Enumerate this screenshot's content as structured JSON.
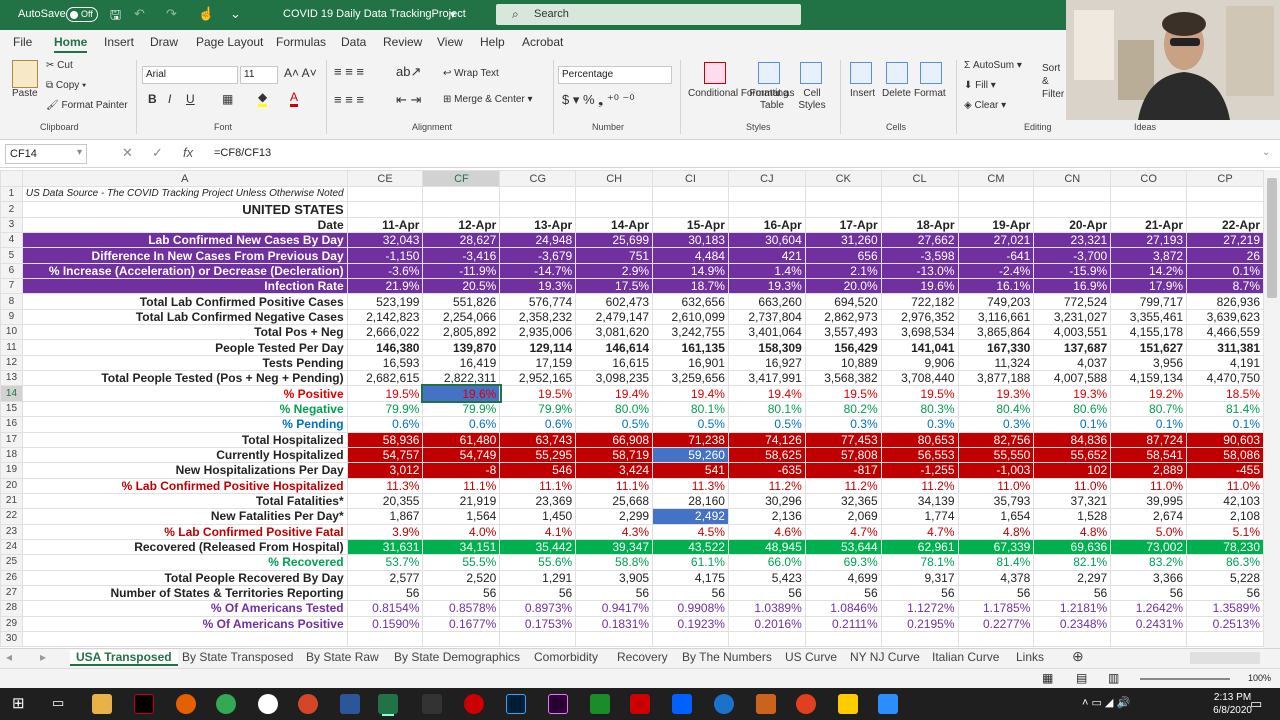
{
  "title_bar": {
    "autosave_label": "AutoSave",
    "autosave_state": "Off",
    "file_name": "COVID 19 Daily Data TrackingProject",
    "search_placeholder": "Search"
  },
  "menu": [
    "File",
    "Home",
    "Insert",
    "Draw",
    "Page Layout",
    "Formulas",
    "Data",
    "Review",
    "View",
    "Help",
    "Acrobat"
  ],
  "ribbon": {
    "paste": "Paste",
    "cut": "Cut",
    "copy": "Copy",
    "format_painter": "Format Painter",
    "clipboard": "Clipboard",
    "font_name": "Arial",
    "font_size": "11",
    "font": "Font",
    "wrap_text": "Wrap Text",
    "merge_center": "Merge & Center",
    "alignment": "Alignment",
    "number_format": "Percentage",
    "number": "Number",
    "conditional_formatting": "Conditional Formatting",
    "format_as_table": "Format as Table",
    "cell_styles": "Cell Styles",
    "styles": "Styles",
    "insert": "Insert",
    "delete": "Delete",
    "format": "Format",
    "cells": "Cells",
    "autosum": "AutoSum",
    "fill": "Fill",
    "clear": "Clear",
    "sort_filter": "Sort & Filter",
    "editing": "Editing",
    "ideas": "Ideas"
  },
  "formula_bar": {
    "name_box": "CF14",
    "formula": "=CF8/CF13",
    "fx": "fx"
  },
  "columns": [
    "A",
    "CE",
    "CF",
    "CG",
    "CH",
    "CI",
    "CJ",
    "CK",
    "CL",
    "CM",
    "CN",
    "CO",
    "CP"
  ],
  "rows": [
    {
      "n": "1",
      "cls": "",
      "label": "US Data Source - The COVID Tracking Project Unless Otherwise Noted",
      "vals": [
        "",
        "",
        "",
        "",
        "",
        "",
        "",
        "",
        "",
        "",
        "",
        ""
      ]
    },
    {
      "n": "2",
      "cls": "",
      "label": "UNITED STATES",
      "vals": [
        "",
        "",
        "",
        "",
        "",
        "",
        "",
        "",
        "",
        "",
        "",
        ""
      ]
    },
    {
      "n": "3",
      "cls": "",
      "label": "Date",
      "vals": [
        "11-Apr",
        "12-Apr",
        "13-Apr",
        "14-Apr",
        "15-Apr",
        "16-Apr",
        "17-Apr",
        "18-Apr",
        "19-Apr",
        "20-Apr",
        "21-Apr",
        "22-Apr"
      ]
    },
    {
      "n": "4",
      "cls": "purple",
      "label": "Lab Confirmed New Cases By Day",
      "vals": [
        "32,043",
        "28,627",
        "24,948",
        "25,699",
        "30,183",
        "30,604",
        "31,260",
        "27,662",
        "27,021",
        "23,321",
        "27,193",
        "27,219"
      ]
    },
    {
      "n": "5",
      "cls": "purple",
      "label": "Difference In New Cases From Previous Day",
      "vals": [
        "-1,150",
        "-3,416",
        "-3,679",
        "751",
        "4,484",
        "421",
        "656",
        "-3,598",
        "-641",
        "-3,700",
        "3,872",
        "26"
      ]
    },
    {
      "n": "6",
      "cls": "purple",
      "label": "% Increase (Acceleration) or Decrease (Decleration)",
      "vals": [
        "-3.6%",
        "-11.9%",
        "-14.7%",
        "2.9%",
        "14.9%",
        "1.4%",
        "2.1%",
        "-13.0%",
        "-2.4%",
        "-15.9%",
        "14.2%",
        "0.1%"
      ]
    },
    {
      "n": "7",
      "cls": "purple",
      "label": "Infection Rate",
      "vals": [
        "21.9%",
        "20.5%",
        "19.3%",
        "17.5%",
        "18.7%",
        "19.3%",
        "20.0%",
        "19.6%",
        "16.1%",
        "16.9%",
        "17.9%",
        "8.7%"
      ]
    },
    {
      "n": "8",
      "cls": "",
      "label": "Total Lab Confirmed Positive Cases",
      "vals": [
        "523,199",
        "551,826",
        "576,774",
        "602,473",
        "632,656",
        "663,260",
        "694,520",
        "722,182",
        "749,203",
        "772,524",
        "799,717",
        "826,936"
      ]
    },
    {
      "n": "9",
      "cls": "",
      "label": "Total Lab Confirmed Negative Cases",
      "vals": [
        "2,142,823",
        "2,254,066",
        "2,358,232",
        "2,479,147",
        "2,610,099",
        "2,737,804",
        "2,862,973",
        "2,976,352",
        "3,116,661",
        "3,231,027",
        "3,355,461",
        "3,639,623"
      ]
    },
    {
      "n": "10",
      "cls": "",
      "label": "Total Pos + Neg",
      "vals": [
        "2,666,022",
        "2,805,892",
        "2,935,006",
        "3,081,620",
        "3,242,755",
        "3,401,064",
        "3,557,493",
        "3,698,534",
        "3,865,864",
        "4,003,551",
        "4,155,178",
        "4,466,559"
      ]
    },
    {
      "n": "11",
      "cls": "",
      "label": "People Tested Per Day",
      "vals": [
        "146,380",
        "139,870",
        "129,114",
        "146,614",
        "161,135",
        "158,309",
        "156,429",
        "141,041",
        "167,330",
        "137,687",
        "151,627",
        "311,381"
      ]
    },
    {
      "n": "12",
      "cls": "",
      "label": "Tests Pending",
      "vals": [
        "16,593",
        "16,419",
        "17,159",
        "16,615",
        "16,901",
        "16,927",
        "10,889",
        "9,906",
        "11,324",
        "4,037",
        "3,956",
        "4,191"
      ]
    },
    {
      "n": "13",
      "cls": "",
      "label": "Total People Tested (Pos + Neg + Pending)",
      "vals": [
        "2,682,615",
        "2,822,311",
        "2,952,165",
        "3,098,235",
        "3,259,656",
        "3,417,991",
        "3,568,382",
        "3,708,440",
        "3,877,188",
        "4,007,588",
        "4,159,134",
        "4,470,750"
      ]
    },
    {
      "n": "14",
      "cls": "cpos",
      "label": "% Positive",
      "vals": [
        "19.5%",
        "19.6%",
        "19.5%",
        "19.4%",
        "19.4%",
        "19.4%",
        "19.5%",
        "19.5%",
        "19.3%",
        "19.3%",
        "19.2%",
        "18.5%"
      ]
    },
    {
      "n": "15",
      "cls": "cneg",
      "label": "% Negative",
      "vals": [
        "79.9%",
        "79.9%",
        "79.9%",
        "80.0%",
        "80.1%",
        "80.1%",
        "80.2%",
        "80.3%",
        "80.4%",
        "80.6%",
        "80.7%",
        "81.4%"
      ]
    },
    {
      "n": "16",
      "cls": "cpen",
      "label": "% Pending",
      "vals": [
        "0.6%",
        "0.6%",
        "0.6%",
        "0.5%",
        "0.5%",
        "0.5%",
        "0.3%",
        "0.3%",
        "0.3%",
        "0.1%",
        "0.1%",
        "0.1%"
      ]
    },
    {
      "n": "17",
      "cls": "red",
      "label": "Total Hospitalized",
      "vals": [
        "58,936",
        "61,480",
        "63,743",
        "66,908",
        "71,238",
        "74,126",
        "77,453",
        "80,653",
        "82,756",
        "84,836",
        "87,724",
        "90,603"
      ]
    },
    {
      "n": "18",
      "cls": "red",
      "label": "Currently Hospitalized",
      "vals": [
        "54,757",
        "54,749",
        "55,295",
        "58,719",
        "59,260",
        "58,625",
        "57,808",
        "56,553",
        "55,550",
        "55,652",
        "58,541",
        "58,086"
      ]
    },
    {
      "n": "19",
      "cls": "red",
      "label": "New Hospitalizations Per Day",
      "vals": [
        "3,012",
        "-8",
        "546",
        "3,424",
        "541",
        "-635",
        "-817",
        "-1,255",
        "-1,003",
        "102",
        "2,889",
        "-455"
      ]
    },
    {
      "n": "20",
      "cls": "cdred",
      "label": "% Lab Confirmed Positive Hospitalized",
      "vals": [
        "11.3%",
        "11.1%",
        "11.1%",
        "11.1%",
        "11.3%",
        "11.2%",
        "11.2%",
        "11.2%",
        "11.0%",
        "11.0%",
        "11.0%",
        "11.0%"
      ]
    },
    {
      "n": "21",
      "cls": "",
      "label": "Total Fatalities*",
      "vals": [
        "20,355",
        "21,919",
        "23,369",
        "25,668",
        "28,160",
        "30,296",
        "32,365",
        "34,139",
        "35,793",
        "37,321",
        "39,995",
        "42,103"
      ]
    },
    {
      "n": "22",
      "cls": "",
      "label": "New Fatalities Per Day*",
      "vals": [
        "1,867",
        "1,564",
        "1,450",
        "2,299",
        "2,492",
        "2,136",
        "2,069",
        "1,774",
        "1,654",
        "1,528",
        "2,674",
        "2,108"
      ]
    },
    {
      "n": "23",
      "cls": "cdred",
      "label": "% Lab Confirmed Positive Fatal",
      "vals": [
        "3.9%",
        "4.0%",
        "4.1%",
        "4.3%",
        "4.5%",
        "4.6%",
        "4.7%",
        "4.7%",
        "4.8%",
        "4.8%",
        "5.0%",
        "5.1%"
      ]
    },
    {
      "n": "24",
      "cls": "green",
      "label": "Recovered (Released From Hospital)",
      "vals": [
        "31,631",
        "34,151",
        "35,442",
        "39,347",
        "43,522",
        "48,945",
        "53,644",
        "62,961",
        "67,339",
        "69,636",
        "73,002",
        "78,230"
      ]
    },
    {
      "n": "25",
      "cls": "cneg",
      "label": "% Recovered",
      "vals": [
        "53.7%",
        "55.5%",
        "55.6%",
        "58.8%",
        "61.1%",
        "66.0%",
        "69.3%",
        "78.1%",
        "81.4%",
        "82.1%",
        "83.2%",
        "86.3%"
      ]
    },
    {
      "n": "26",
      "cls": "",
      "label": "Total People Recovered By Day",
      "vals": [
        "2,577",
        "2,520",
        "1,291",
        "3,905",
        "4,175",
        "5,423",
        "4,699",
        "9,317",
        "4,378",
        "2,297",
        "3,366",
        "5,228"
      ]
    },
    {
      "n": "27",
      "cls": "",
      "label": "Number of States & Territories Reporting",
      "vals": [
        "56",
        "56",
        "56",
        "56",
        "56",
        "56",
        "56",
        "56",
        "56",
        "56",
        "56",
        "56"
      ]
    },
    {
      "n": "28",
      "cls": "cpur",
      "label": "% Of Americans Tested",
      "vals": [
        "0.8154%",
        "0.8578%",
        "0.8973%",
        "0.9417%",
        "0.9908%",
        "1.0389%",
        "1.0846%",
        "1.1272%",
        "1.1785%",
        "1.2181%",
        "1.2642%",
        "1.3589%"
      ]
    },
    {
      "n": "29",
      "cls": "cpur",
      "label": "% Of Americans Positive",
      "vals": [
        "0.1590%",
        "0.1677%",
        "0.1753%",
        "0.1831%",
        "0.1923%",
        "0.2016%",
        "0.2111%",
        "0.2195%",
        "0.2277%",
        "0.2348%",
        "0.2431%",
        "0.2513%"
      ]
    },
    {
      "n": "30",
      "cls": "",
      "label": "",
      "vals": [
        "",
        "",
        "",
        "",
        "",
        "",
        "",
        "",
        "",
        "",
        "",
        ""
      ]
    }
  ],
  "sheet_tabs": [
    "USA Transposed",
    "By State Transposed",
    "By State Raw",
    "By State Demographics",
    "Comorbidity",
    "Recovery",
    "By The Numbers",
    "US Curve",
    "NY NJ Curve",
    "Italian Curve",
    "Links"
  ],
  "status": {
    "zoom": "100%"
  },
  "taskbar": {
    "time": "2:13 PM",
    "date": "6/8/2020"
  }
}
